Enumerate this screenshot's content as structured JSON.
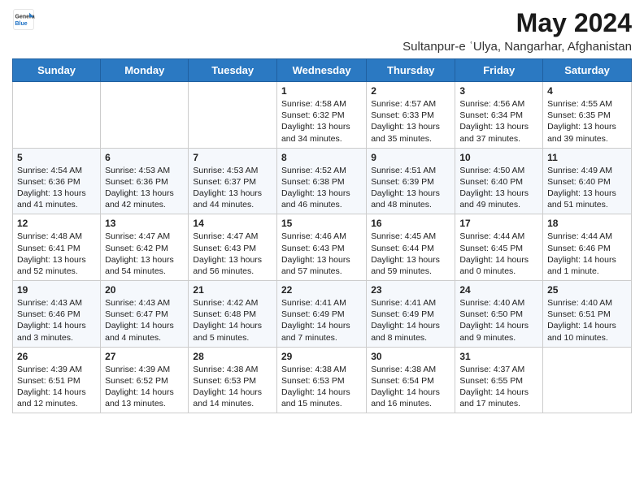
{
  "logo": {
    "line1": "General",
    "line2": "Blue"
  },
  "title": "May 2024",
  "subtitle": "Sultanpur-e ʿUlya, Nangarhar, Afghanistan",
  "days_of_week": [
    "Sunday",
    "Monday",
    "Tuesday",
    "Wednesday",
    "Thursday",
    "Friday",
    "Saturday"
  ],
  "weeks": [
    [
      {
        "day": "",
        "info": ""
      },
      {
        "day": "",
        "info": ""
      },
      {
        "day": "",
        "info": ""
      },
      {
        "day": "1",
        "info": "Sunrise: 4:58 AM\nSunset: 6:32 PM\nDaylight: 13 hours and 34 minutes."
      },
      {
        "day": "2",
        "info": "Sunrise: 4:57 AM\nSunset: 6:33 PM\nDaylight: 13 hours and 35 minutes."
      },
      {
        "day": "3",
        "info": "Sunrise: 4:56 AM\nSunset: 6:34 PM\nDaylight: 13 hours and 37 minutes."
      },
      {
        "day": "4",
        "info": "Sunrise: 4:55 AM\nSunset: 6:35 PM\nDaylight: 13 hours and 39 minutes."
      }
    ],
    [
      {
        "day": "5",
        "info": "Sunrise: 4:54 AM\nSunset: 6:36 PM\nDaylight: 13 hours and 41 minutes."
      },
      {
        "day": "6",
        "info": "Sunrise: 4:53 AM\nSunset: 6:36 PM\nDaylight: 13 hours and 42 minutes."
      },
      {
        "day": "7",
        "info": "Sunrise: 4:53 AM\nSunset: 6:37 PM\nDaylight: 13 hours and 44 minutes."
      },
      {
        "day": "8",
        "info": "Sunrise: 4:52 AM\nSunset: 6:38 PM\nDaylight: 13 hours and 46 minutes."
      },
      {
        "day": "9",
        "info": "Sunrise: 4:51 AM\nSunset: 6:39 PM\nDaylight: 13 hours and 48 minutes."
      },
      {
        "day": "10",
        "info": "Sunrise: 4:50 AM\nSunset: 6:40 PM\nDaylight: 13 hours and 49 minutes."
      },
      {
        "day": "11",
        "info": "Sunrise: 4:49 AM\nSunset: 6:40 PM\nDaylight: 13 hours and 51 minutes."
      }
    ],
    [
      {
        "day": "12",
        "info": "Sunrise: 4:48 AM\nSunset: 6:41 PM\nDaylight: 13 hours and 52 minutes."
      },
      {
        "day": "13",
        "info": "Sunrise: 4:47 AM\nSunset: 6:42 PM\nDaylight: 13 hours and 54 minutes."
      },
      {
        "day": "14",
        "info": "Sunrise: 4:47 AM\nSunset: 6:43 PM\nDaylight: 13 hours and 56 minutes."
      },
      {
        "day": "15",
        "info": "Sunrise: 4:46 AM\nSunset: 6:43 PM\nDaylight: 13 hours and 57 minutes."
      },
      {
        "day": "16",
        "info": "Sunrise: 4:45 AM\nSunset: 6:44 PM\nDaylight: 13 hours and 59 minutes."
      },
      {
        "day": "17",
        "info": "Sunrise: 4:44 AM\nSunset: 6:45 PM\nDaylight: 14 hours and 0 minutes."
      },
      {
        "day": "18",
        "info": "Sunrise: 4:44 AM\nSunset: 6:46 PM\nDaylight: 14 hours and 1 minute."
      }
    ],
    [
      {
        "day": "19",
        "info": "Sunrise: 4:43 AM\nSunset: 6:46 PM\nDaylight: 14 hours and 3 minutes."
      },
      {
        "day": "20",
        "info": "Sunrise: 4:43 AM\nSunset: 6:47 PM\nDaylight: 14 hours and 4 minutes."
      },
      {
        "day": "21",
        "info": "Sunrise: 4:42 AM\nSunset: 6:48 PM\nDaylight: 14 hours and 5 minutes."
      },
      {
        "day": "22",
        "info": "Sunrise: 4:41 AM\nSunset: 6:49 PM\nDaylight: 14 hours and 7 minutes."
      },
      {
        "day": "23",
        "info": "Sunrise: 4:41 AM\nSunset: 6:49 PM\nDaylight: 14 hours and 8 minutes."
      },
      {
        "day": "24",
        "info": "Sunrise: 4:40 AM\nSunset: 6:50 PM\nDaylight: 14 hours and 9 minutes."
      },
      {
        "day": "25",
        "info": "Sunrise: 4:40 AM\nSunset: 6:51 PM\nDaylight: 14 hours and 10 minutes."
      }
    ],
    [
      {
        "day": "26",
        "info": "Sunrise: 4:39 AM\nSunset: 6:51 PM\nDaylight: 14 hours and 12 minutes."
      },
      {
        "day": "27",
        "info": "Sunrise: 4:39 AM\nSunset: 6:52 PM\nDaylight: 14 hours and 13 minutes."
      },
      {
        "day": "28",
        "info": "Sunrise: 4:38 AM\nSunset: 6:53 PM\nDaylight: 14 hours and 14 minutes."
      },
      {
        "day": "29",
        "info": "Sunrise: 4:38 AM\nSunset: 6:53 PM\nDaylight: 14 hours and 15 minutes."
      },
      {
        "day": "30",
        "info": "Sunrise: 4:38 AM\nSunset: 6:54 PM\nDaylight: 14 hours and 16 minutes."
      },
      {
        "day": "31",
        "info": "Sunrise: 4:37 AM\nSunset: 6:55 PM\nDaylight: 14 hours and 17 minutes."
      },
      {
        "day": "",
        "info": ""
      }
    ]
  ]
}
